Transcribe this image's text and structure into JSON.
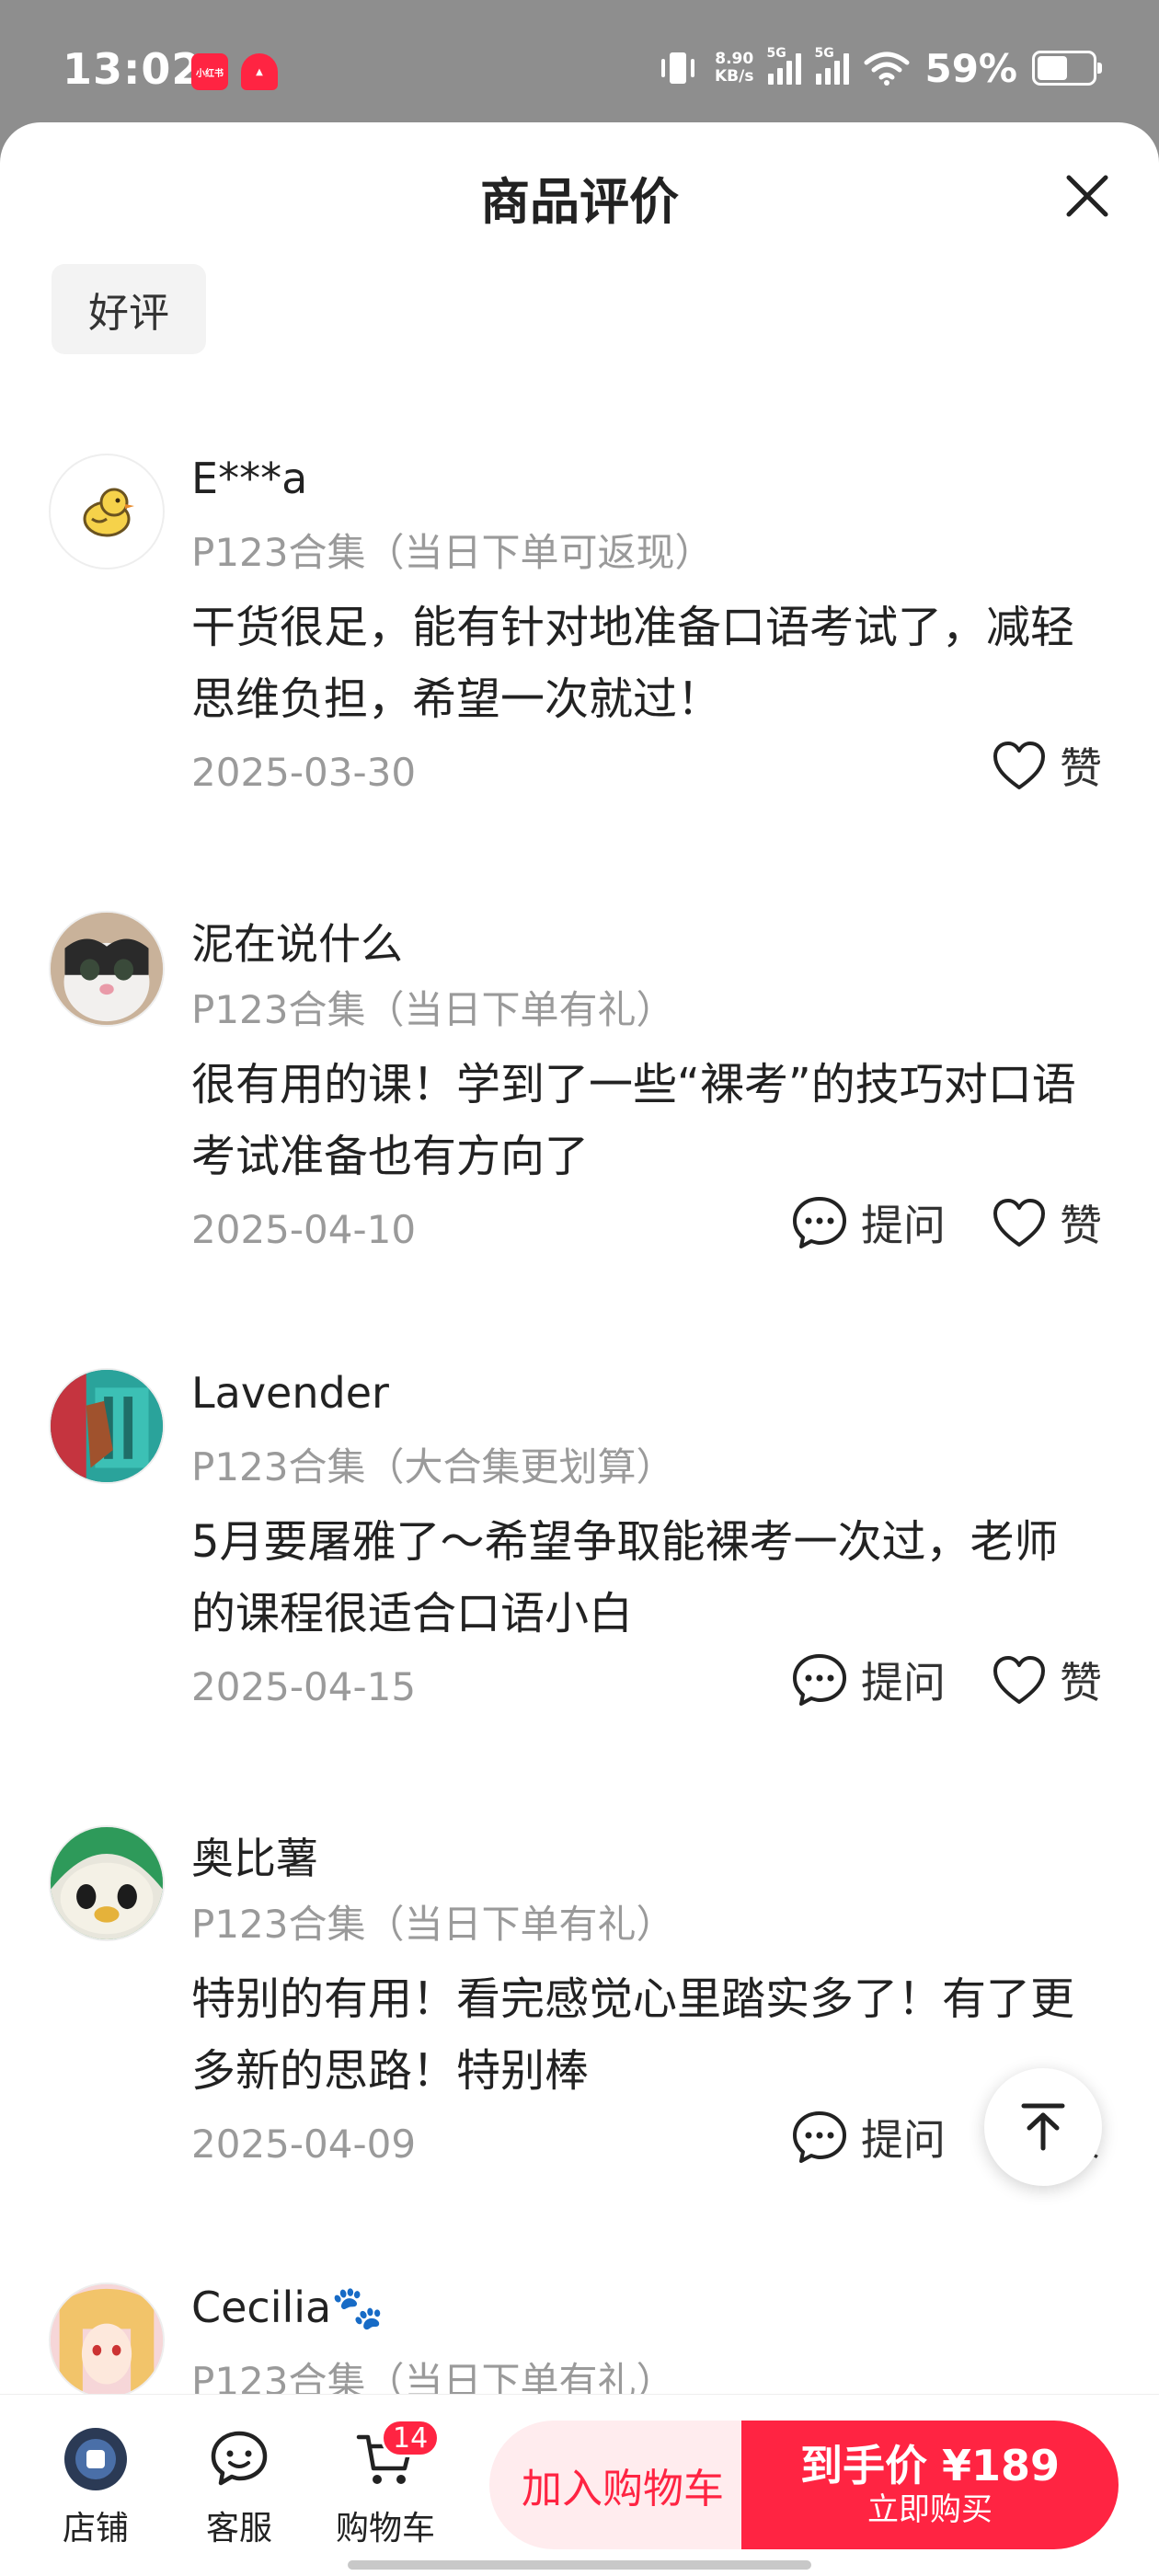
{
  "status_bar": {
    "time": "13:02",
    "app1": "小红书",
    "speed_value": "8.90",
    "speed_unit": "KB/s",
    "sig1": "5G",
    "sig2": "5G",
    "battery": "59%",
    "battery_level": 0.59
  },
  "sheet": {
    "title": "商品评价",
    "filter": "好评"
  },
  "reviews": [
    {
      "user": "E***a",
      "variant": "P123合集（当日下单可返现）",
      "text": "干货很足，能有针对地准备口语考试了，减轻思维负担，希望一次就过！",
      "date": "2025-03-30",
      "like": "赞",
      "avatar": "duck-avatar"
    },
    {
      "user": "泥在说什么",
      "variant": "P123合集（当日下单有礼）",
      "text": "很有用的课！学到了一些“裸考”的技巧对口语考试准备也有方向了",
      "date": "2025-04-10",
      "ask": "提问",
      "like": "赞",
      "avatar": "cat-avatar"
    },
    {
      "user": "Lavender",
      "variant": "P123合集（大合集更划算）",
      "text": "5月要屠雅了～希望争取能裸考一次过，老师的课程很适合口语小白",
      "date": "2025-04-15",
      "ask": "提问",
      "like": "赞",
      "avatar": "photo-avatar"
    },
    {
      "user": "奥比薯",
      "variant": "P123合集（当日下单有礼）",
      "text": "特别的有用！看完感觉心里踏实多了！有了更多新的思路！特别棒",
      "date": "2025-04-09",
      "ask": "提问",
      "like": "赞",
      "avatar": "bird-avatar"
    },
    {
      "user": "Cecilia🐾",
      "variant": "P123合集（当日下单有礼）",
      "avatar": "anime-avatar"
    }
  ],
  "bottom_bar": {
    "shop": "店铺",
    "service": "客服",
    "cart": "购物车",
    "cart_count": "14",
    "add_to_cart": "加入购物车",
    "buy_price": "到手价 ¥189",
    "buy_now": "立即购买"
  },
  "colors": {
    "accent": "#ff2442",
    "accent_light": "#ffecee",
    "muted_text": "#9a9a9a"
  }
}
